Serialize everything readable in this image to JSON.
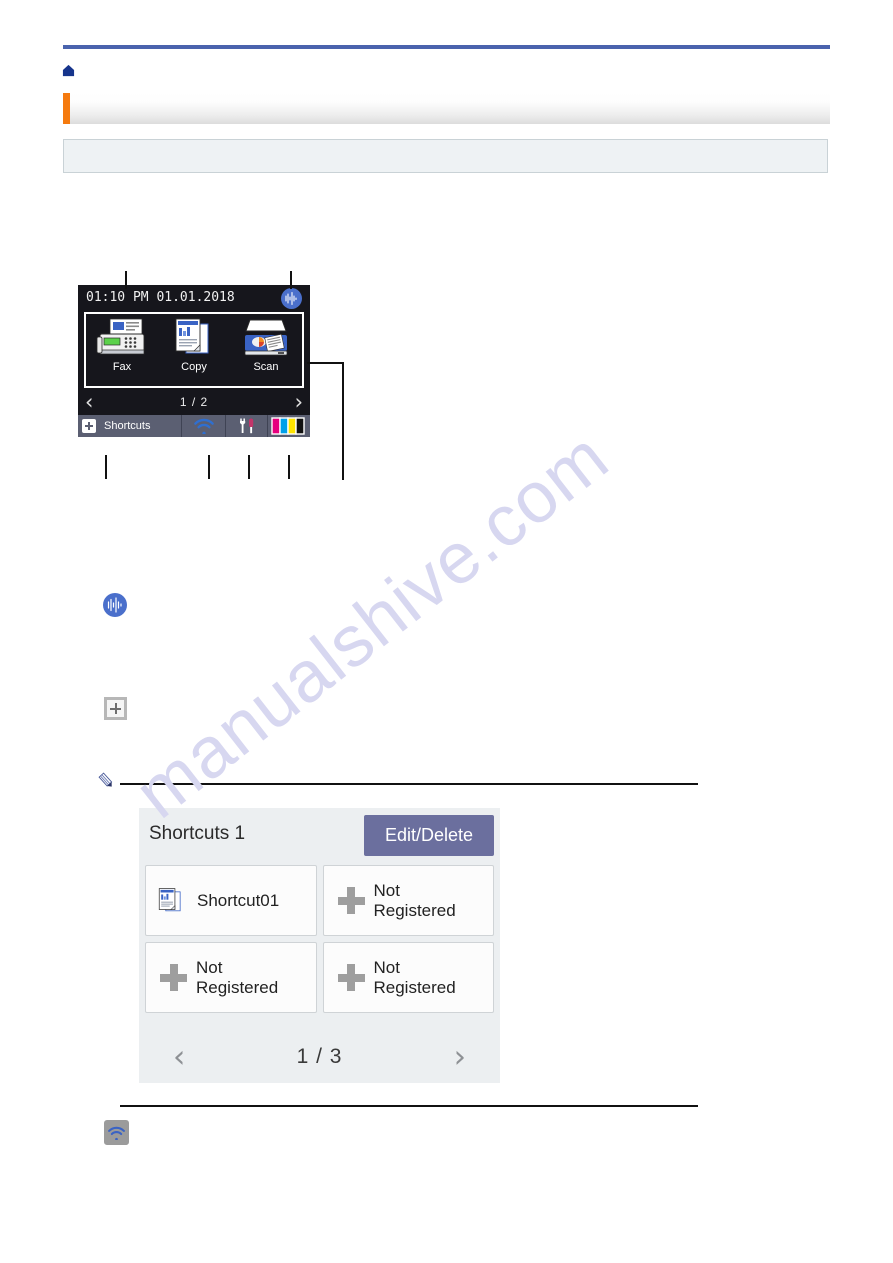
{
  "page": {
    "watermark": "manualshive.com",
    "breadcrumb_icon": "home-icon",
    "title": "",
    "info_note": ""
  },
  "lcd_diagram": {
    "status_bar": {
      "time": "01:10 PM  01.01.2018",
      "toner_icon": "toner-status-icon"
    },
    "apps": [
      {
        "label": "Fax",
        "icon": "fax-machine-icon"
      },
      {
        "label": "Copy",
        "icon": "copy-documents-icon"
      },
      {
        "label": "Scan",
        "icon": "scanner-icon"
      }
    ],
    "page_indicator": "1 / 2",
    "prev_chevron": "‹",
    "next_chevron": "›",
    "toolbar": {
      "shortcuts_label": "Shortcuts",
      "shortcuts_plus_icon": "plus-icon",
      "wifi_icon": "wifi-icon",
      "settings_icon": "settings-wrench-icon",
      "ink_icon": "ink-level-icon",
      "ink_colors": [
        "#e6007e",
        "#00a0e9",
        "#ffe400",
        "#111111"
      ]
    }
  },
  "inline_icons": {
    "toner": "toner-status-icon",
    "add_shortcut": "plus-icon",
    "wifi": "wifi-icon"
  },
  "note": {
    "pencil_icon": "pencil-note-icon",
    "text": ""
  },
  "shortcuts_screen": {
    "title": "Shortcuts 1",
    "edit_delete_label": "Edit/Delete",
    "tiles": [
      {
        "label": "Shortcut01",
        "type": "registered",
        "icon": "copy-documents-icon"
      },
      {
        "label": "Not\nRegistered",
        "type": "empty",
        "icon": "plus-icon"
      },
      {
        "label": "Not\nRegistered",
        "type": "empty",
        "icon": "plus-icon"
      },
      {
        "label": "Not\nRegistered",
        "type": "empty",
        "icon": "plus-icon"
      }
    ],
    "page_indicator": "1 / 3",
    "prev_chevron": "‹",
    "next_chevron": "›"
  },
  "colors": {
    "rule_blue": "#4a63ad",
    "accent_orange": "#f57a0e",
    "home_navy": "#16348c",
    "lcd_background": "#16161c",
    "toolbar_grey": "#5b5f72",
    "button_purple": "#6b6f9e",
    "info_box": "#eef2f4"
  }
}
